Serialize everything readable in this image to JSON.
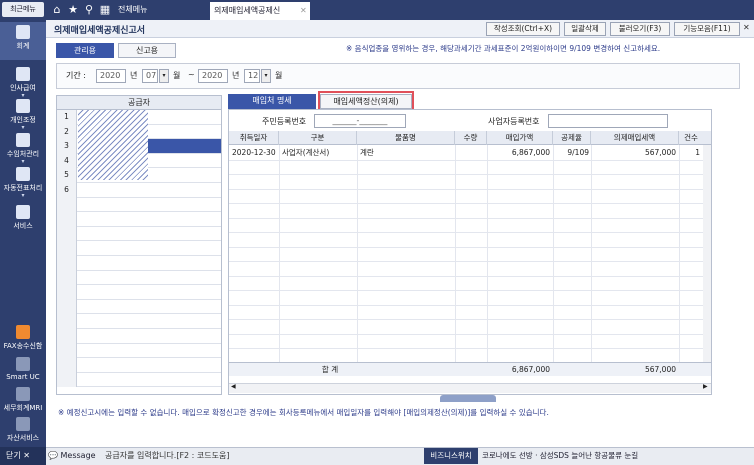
{
  "sidebar": {
    "recent": "최근메뉴",
    "items": [
      "회계",
      "인사급여",
      "개인조정",
      "수임처관리",
      "자동전표처리",
      "서비스"
    ],
    "lower_items": [
      "FAX송수신함",
      "Smart UC",
      "세무회계MRI",
      "자산서비스"
    ],
    "close": "닫기"
  },
  "topbar": {
    "menu_all": "전체메뉴",
    "doc_tab": "의제매입세액공제신"
  },
  "title": "의제매입세액공제신고서",
  "toolbar": {
    "query": "작성조회(Ctrl+X)",
    "delete": "일괄삭제",
    "load": "불러오기(F3)",
    "features": "기능모음(F11)"
  },
  "subtabs": [
    "관리용",
    "신고용"
  ],
  "notice": "※ 음식업종을 영위하는 경우, 해당과세기간 과세표준이 2억원이하이면 9/109 변경하여 신고하세요.",
  "period": {
    "label": "기간 :",
    "from_year": "2020",
    "from_month": "07",
    "to_year": "2020",
    "to_month": "12",
    "year_suffix": "년",
    "month_suffix": "월",
    "tilde": "~"
  },
  "left_grid": {
    "header": "공급자",
    "rows": [
      "1",
      "2",
      "3",
      "4",
      "5",
      "6"
    ]
  },
  "right_tabs": [
    "매입처 명세",
    "매입세액정산(의제)"
  ],
  "id_fields": {
    "resident_label": "주민등록번호",
    "resident_value": "______-_______",
    "business_label": "사업자등록번호"
  },
  "table": {
    "headers": [
      "취득일자",
      "구분",
      "물품명",
      "수량",
      "매입가액",
      "공제율",
      "의제매입세액",
      "건수"
    ],
    "rows": [
      {
        "date": "2020-12-30",
        "type": "사업자(계산서)",
        "item": "계란",
        "qty": "",
        "amount": "6,867,000",
        "rate": "9/109",
        "tax": "567,000",
        "count": "1"
      }
    ],
    "total_label": "합 계",
    "total_amount": "6,867,000",
    "total_tax": "567,000"
  },
  "bottom_note": "※ 예정신고시에는 입력할 수 없습니다. 매입으로 확정신고한 경우에는 회사등록메뉴에서 매입일자를 입력해야 [매입의제정산(의제)]를 입력하실 수 있습니다.",
  "status": {
    "message": "Message",
    "text": "공급자를 입력합니다.[F2 : 코드도움]",
    "biz_btn": "비즈니스위치",
    "ticker": "코로나에도 선방 · 삼성SDS 늘어난 항공물류 눈길"
  }
}
